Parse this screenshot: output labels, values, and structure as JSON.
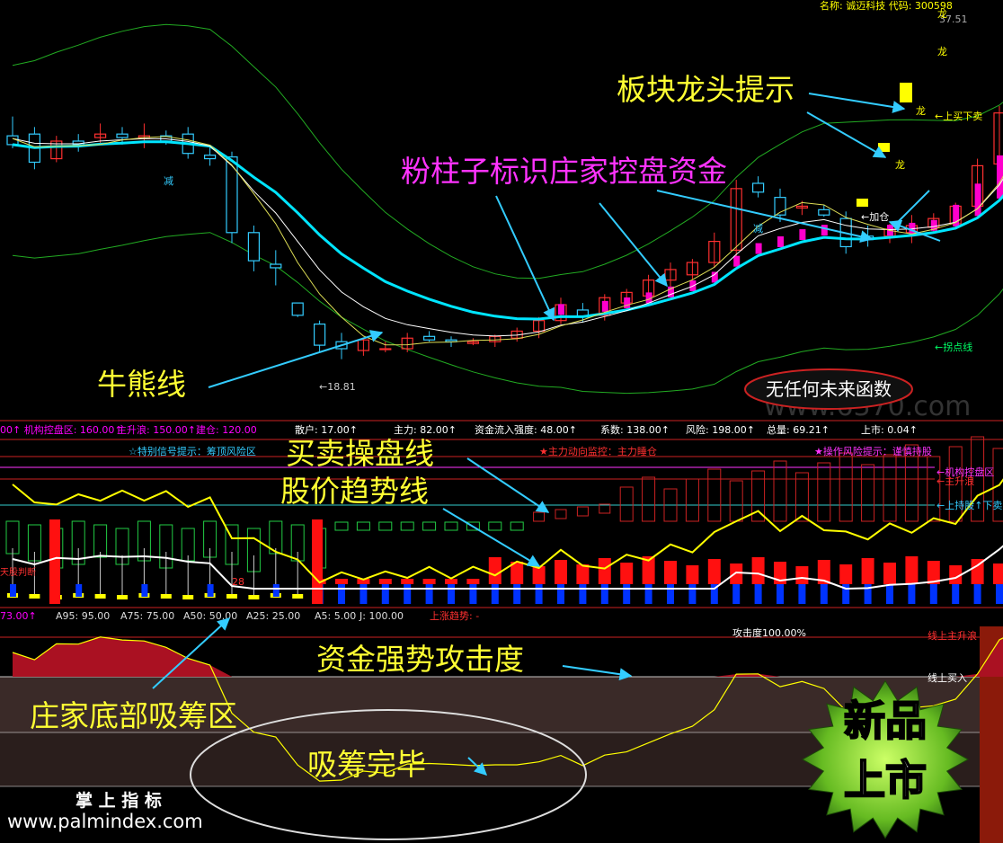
{
  "colors": {
    "up": "#ff3030",
    "down": "#33ccff",
    "white": "#ffffff",
    "yellow": "#ffff00",
    "cyan": "#00e5ff",
    "green": "#22aa22",
    "magenta": "#ff00ff",
    "pink": "#ff66cc",
    "blue": "#0033ff",
    "annot": "#ffff33",
    "annot_magenta": "#ff33ff",
    "arrow": "#33ccff",
    "sep": "#cc2222",
    "maroon": "#aa1122",
    "stripe_brown": "#3a2a28",
    "blue_area": "#1a66cc"
  },
  "header": {
    "stock_name": "名称: 诚迈科技 代码: 300598",
    "price_top": "37.51",
    "long_label": "龙",
    "low_label": "18.81",
    "jiacang": "←加仓",
    "jian": "减"
  },
  "right_labels": {
    "buy_sell": "←上买下卖",
    "guaidian": "←拐点线",
    "jigou": "←机构控盘区",
    "zhusheng": "←主升浪",
    "shangchi": "←上持股↑下卖",
    "attack": "攻击度100.00%",
    "line_up": "线上主升浪",
    "line_buy": "线上买入"
  },
  "status_bar": {
    "items": [
      {
        "label": "机构控盘区",
        "value": "160.00"
      },
      {
        "label": "主升浪",
        "value": "150.00"
      },
      {
        "label": "建仓",
        "value": "120.00"
      },
      {
        "label": "散户",
        "value": "17.00"
      },
      {
        "label": "主力",
        "value": "82.00"
      },
      {
        "label": "资金流入强度",
        "value": "48.00"
      },
      {
        "label": "系数",
        "value": "138.00"
      },
      {
        "label": "风险",
        "value": "198.00"
      },
      {
        "label": "总量",
        "value": "69.21"
      },
      {
        "label": "上市",
        "value": "0.04"
      }
    ]
  },
  "panel2": {
    "signal": "☆特别信号提示：筹顶风险区",
    "monitor": "★主力动向监控：主力睡仓",
    "risk": "★操作风险提示：谨慎持股",
    "left_tag": "天股判断",
    "num_28": "28"
  },
  "panel3_status": {
    "items": [
      {
        "label": "",
        "value": "73.00"
      },
      {
        "label": "A95",
        "value": "95.00"
      },
      {
        "label": "A75",
        "value": "75.00"
      },
      {
        "label": "A50",
        "value": "50.00"
      },
      {
        "label": "A25",
        "value": "25.00"
      },
      {
        "label": "A5",
        "value": "5.00"
      },
      {
        "label": "J",
        "value": "100.00"
      },
      {
        "label": "上涨趋势",
        "value": "-"
      }
    ]
  },
  "annotations": {
    "bankuai": "板块龙头提示",
    "fenzhu": "粉柱子标识庄家控盘资金",
    "niuxiong": "牛熊线",
    "wurenhe": "无任何未来函数",
    "maimai": "买卖操盘线",
    "gujia": "股价趋势线",
    "zijin": "资金强势攻击度",
    "zhuangjia": "庄家底部吸筹区",
    "xichou": "吸筹完毕",
    "zhangshang": "掌 上 指 标",
    "website": "www.palmindex.com",
    "watermark": "www.6370.com",
    "badge": "新品上市"
  },
  "chart_data": [
    {
      "type": "candlestick",
      "candles": [
        {
          "open": 31.5,
          "high": 32.6,
          "low": 30.8,
          "close": 31.0
        },
        {
          "open": 31.6,
          "high": 32.0,
          "low": 29.6,
          "close": 30.0
        },
        {
          "open": 30.2,
          "high": 31.5,
          "low": 30.0,
          "close": 31.2
        },
        {
          "open": 31.2,
          "high": 31.6,
          "low": 30.6,
          "close": 31.0
        },
        {
          "open": 31.4,
          "high": 32.2,
          "low": 31.0,
          "close": 31.6
        },
        {
          "open": 31.6,
          "high": 32.0,
          "low": 31.0,
          "close": 31.4
        },
        {
          "open": 31.4,
          "high": 32.2,
          "low": 30.8,
          "close": 31.5
        },
        {
          "open": 31.5,
          "high": 31.8,
          "low": 31.0,
          "close": 31.2
        },
        {
          "open": 31.6,
          "high": 32.0,
          "low": 30.2,
          "close": 30.5
        },
        {
          "open": 30.4,
          "high": 30.9,
          "low": 29.8,
          "close": 30.2
        },
        {
          "open": 30.3,
          "high": 30.6,
          "low": 25.4,
          "close": 26.0
        },
        {
          "open": 26.0,
          "high": 26.4,
          "low": 23.8,
          "close": 24.4
        },
        {
          "open": 24.2,
          "high": 25.0,
          "low": 23.0,
          "close": 24.0
        },
        {
          "open": 22.0,
          "high": 22.0,
          "low": 21.2,
          "close": 21.3
        },
        {
          "open": 20.8,
          "high": 21.0,
          "low": 19.2,
          "close": 19.6
        },
        {
          "open": 19.8,
          "high": 20.3,
          "low": 18.81,
          "close": 19.4
        },
        {
          "open": 19.3,
          "high": 20.0,
          "low": 19.0,
          "close": 19.9
        },
        {
          "open": 19.4,
          "high": 19.8,
          "low": 19.2,
          "close": 19.4
        },
        {
          "open": 19.4,
          "high": 20.3,
          "low": 19.2,
          "close": 20.0
        },
        {
          "open": 20.1,
          "high": 20.4,
          "low": 19.8,
          "close": 19.9
        },
        {
          "open": 19.9,
          "high": 20.1,
          "low": 19.5,
          "close": 19.8
        },
        {
          "open": 19.7,
          "high": 20.0,
          "low": 19.6,
          "close": 19.8
        },
        {
          "open": 19.8,
          "high": 20.2,
          "low": 19.5,
          "close": 20.1
        },
        {
          "open": 20.0,
          "high": 20.6,
          "low": 19.8,
          "close": 20.4
        },
        {
          "open": 20.4,
          "high": 21.2,
          "low": 20.0,
          "close": 21.0
        },
        {
          "open": 21.0,
          "high": 22.3,
          "low": 20.8,
          "close": 21.9
        },
        {
          "open": 21.6,
          "high": 22.0,
          "low": 20.9,
          "close": 21.2
        },
        {
          "open": 21.3,
          "high": 22.5,
          "low": 21.0,
          "close": 22.3
        },
        {
          "open": 22.0,
          "high": 22.8,
          "low": 21.6,
          "close": 22.6
        },
        {
          "open": 22.4,
          "high": 23.6,
          "low": 22.0,
          "close": 23.3
        },
        {
          "open": 23.3,
          "high": 24.3,
          "low": 22.8,
          "close": 23.9
        },
        {
          "open": 23.6,
          "high": 24.5,
          "low": 23.3,
          "close": 24.3
        },
        {
          "open": 24.3,
          "high": 26.0,
          "low": 24.0,
          "close": 25.5
        },
        {
          "open": 25.0,
          "high": 29.0,
          "low": 24.6,
          "close": 28.5
        },
        {
          "open": 28.8,
          "high": 29.2,
          "low": 28.0,
          "close": 28.3
        },
        {
          "open": 28.0,
          "high": 28.5,
          "low": 26.6,
          "close": 27.0
        },
        {
          "open": 27.4,
          "high": 27.8,
          "low": 27.0,
          "close": 27.5
        },
        {
          "open": 27.3,
          "high": 27.6,
          "low": 26.9,
          "close": 27.0
        },
        {
          "open": 26.8,
          "high": 27.2,
          "low": 24.8,
          "close": 25.2
        },
        {
          "open": 25.8,
          "high": 26.4,
          "low": 25.2,
          "close": 25.6
        },
        {
          "open": 25.8,
          "high": 26.5,
          "low": 25.4,
          "close": 26.2
        },
        {
          "open": 26.0,
          "high": 27.0,
          "low": 25.4,
          "close": 26.4
        },
        {
          "open": 26.3,
          "high": 27.1,
          "low": 26.0,
          "close": 26.8
        },
        {
          "open": 26.5,
          "high": 27.7,
          "low": 26.2,
          "close": 27.5
        },
        {
          "open": 27.5,
          "high": 30.2,
          "low": 27.2,
          "close": 29.8
        },
        {
          "open": 29.9,
          "high": 33.2,
          "low": 29.6,
          "close": 32.8
        },
        {
          "open": 33.0,
          "high": 37.51,
          "low": 32.8,
          "close": 36.4
        }
      ]
    }
  ]
}
